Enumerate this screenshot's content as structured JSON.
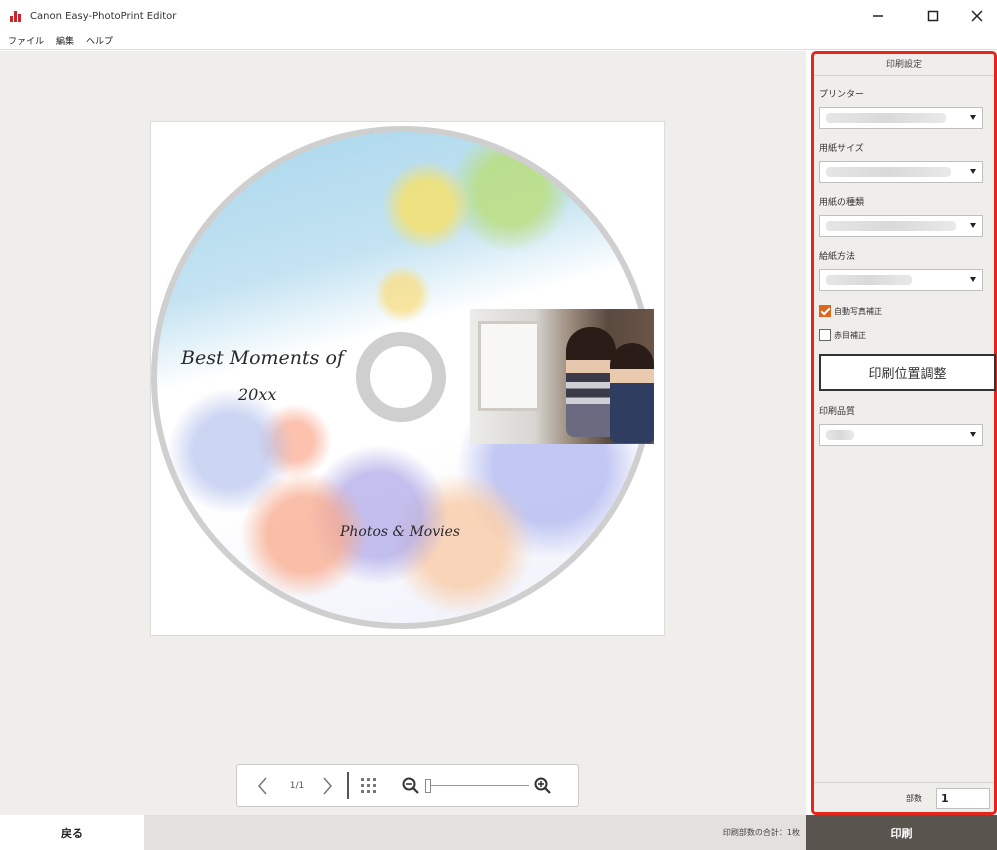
{
  "window": {
    "title": "Canon Easy-PhotoPrint Editor",
    "min_icon": "minimize-icon",
    "max_icon": "maximize-icon",
    "close_icon": "close-icon"
  },
  "menu": [
    "ファイル",
    "編集",
    "ヘルプ"
  ],
  "disc": {
    "title_line1": "Best Moments of",
    "title_line2": "20xx",
    "subtitle": "Photos & Movies"
  },
  "navigation": {
    "page": "1/1",
    "prev_icon": "chevron-left-icon",
    "next_icon": "chevron-right-icon",
    "grid_icon": "grid-icon",
    "zoom_out_icon": "zoom-out-icon",
    "zoom_in_icon": "zoom-in-icon",
    "zoom_level": 0
  },
  "panel": {
    "header": "印刷設定",
    "printer_label": "プリンター",
    "paper_size_label": "用紙サイズ",
    "media_type_label": "用紙の種類",
    "paper_source_label": "給紙方法",
    "auto_photo_fix_label": "自動写真補正",
    "auto_photo_fix_checked": true,
    "red_eye_label": "赤目補正",
    "red_eye_checked": false,
    "print_area_button": "印刷位置調整",
    "quality_label": "印刷品質",
    "copies_label": "部数",
    "copies_value": "1"
  },
  "bottom": {
    "back_label": "戻る",
    "total_label": "印刷部数の合計：1枚",
    "print_label": "印刷"
  },
  "colors": {
    "accent_border": "#e8251b",
    "checkbox": "#e0661e",
    "print_bg": "#5a544f"
  }
}
